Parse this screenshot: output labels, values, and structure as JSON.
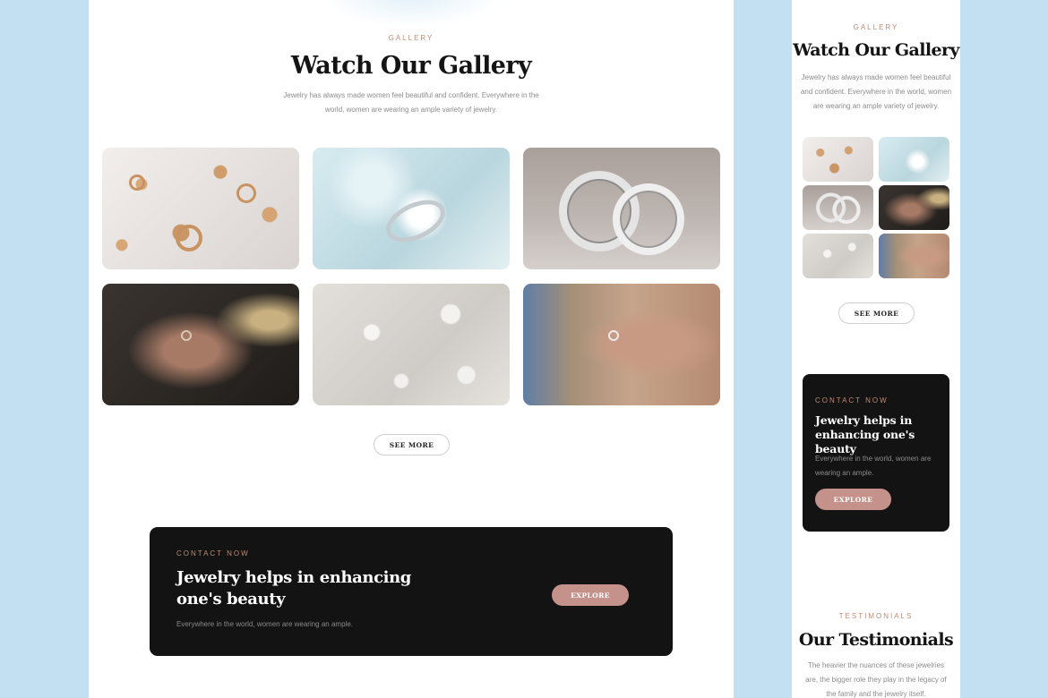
{
  "gallery": {
    "eyebrow": "GALLERY",
    "title": "Watch Our Gallery",
    "subtitle": "Jewelry has always made women feel beautiful and confident. Everywhere in the world, women are wearing an ample variety of jewelry.",
    "see_more_label": "SEE MORE",
    "images": [
      {
        "name": "gold-rings-display-photo"
      },
      {
        "name": "diamond-ring-closeup-photo"
      },
      {
        "name": "silver-wedding-bands-photo"
      },
      {
        "name": "hand-with-ring-photo"
      },
      {
        "name": "crystals-on-fabric-photo"
      },
      {
        "name": "woman-hand-ring-photo"
      }
    ]
  },
  "contact": {
    "eyebrow": "CONTACT NOW",
    "title": "Jewelry helps in enhancing one's beauty",
    "subtitle": "Everywhere in the world, women are wearing an ample.",
    "explore_label": "EXPLORE"
  },
  "testimonials": {
    "eyebrow": "TESTIMONIALS",
    "title": "Our Testimonials",
    "subtitle": "The heavier the nuances of these jewelries are, the bigger role they play in the legacy of the family and the jewelry itself."
  },
  "colors": {
    "background": "#c3e0f3",
    "accent": "#c08b74",
    "button_fill": "#c4928a",
    "dark_card": "#141313"
  }
}
